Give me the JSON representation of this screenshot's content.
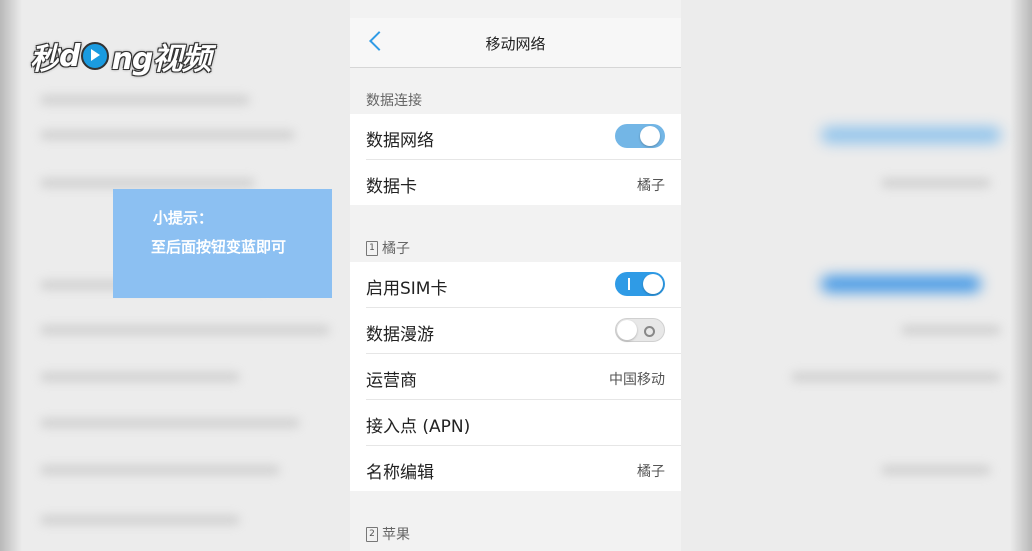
{
  "logo": {
    "pre": "秒",
    "mid": "d",
    "post": "ng视频"
  },
  "tip": {
    "line1": "小提示：",
    "line2": "至后面按钮变蓝即可"
  },
  "nav": {
    "title": "移动网络"
  },
  "sections": {
    "data_connection": {
      "header": "数据连接",
      "rows": [
        {
          "label": "数据网络",
          "toggle": "on"
        },
        {
          "label": "数据卡",
          "value": "橘子"
        }
      ]
    },
    "sim1": {
      "header": "橘子",
      "sim_number": "1",
      "rows": [
        {
          "label": "启用SIM卡",
          "toggle": "on"
        },
        {
          "label": "数据漫游",
          "toggle": "off"
        },
        {
          "label": "运营商",
          "value": "中国移动"
        },
        {
          "label": "接入点 (APN)"
        },
        {
          "label": "名称编辑",
          "value": "橘子"
        }
      ]
    },
    "sim2": {
      "header": "苹果",
      "sim_number": "2"
    }
  },
  "colors": {
    "accent": "#2f9be6",
    "tip_bg": "#8cc0f2"
  }
}
